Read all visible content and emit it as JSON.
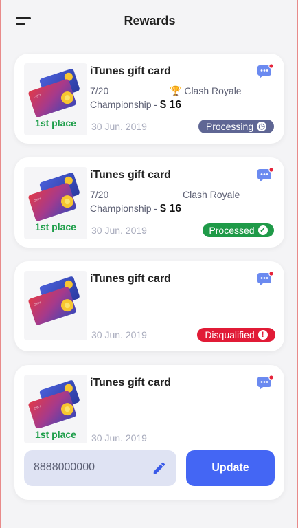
{
  "header": {
    "title": "Rewards"
  },
  "rewards": [
    {
      "title": "iTunes gift card",
      "progress": "7/20",
      "game": "Clash Royale",
      "championship": "Championship -",
      "amount": "$ 16",
      "date": "30 Jun. 2019",
      "place": "1st place",
      "status": "Processing",
      "status_icon": "clock-icon",
      "status_color": "#5f6694"
    },
    {
      "title": "iTunes gift card",
      "progress": "7/20",
      "game": "Clash Royale",
      "championship": "Championship -",
      "amount": "$ 16",
      "date": "30 Jun. 2019",
      "place": "1st place",
      "status": "Processed",
      "status_icon": "check-icon",
      "status_color": "#1f9a48"
    },
    {
      "title": "iTunes gift card",
      "date": "30 Jun. 2019",
      "status": "Disqualified",
      "status_icon": "exclamation-icon",
      "status_color": "#e11b36"
    },
    {
      "title": "iTunes gift card",
      "date": "30 Jun. 2019",
      "place": "1st place",
      "phone": {
        "value": "8888000000"
      },
      "update_label": "Update"
    }
  ],
  "colors": {
    "accent": "#4466f4",
    "place": "#1e9e4a",
    "notification_dot": "#e5233a"
  }
}
